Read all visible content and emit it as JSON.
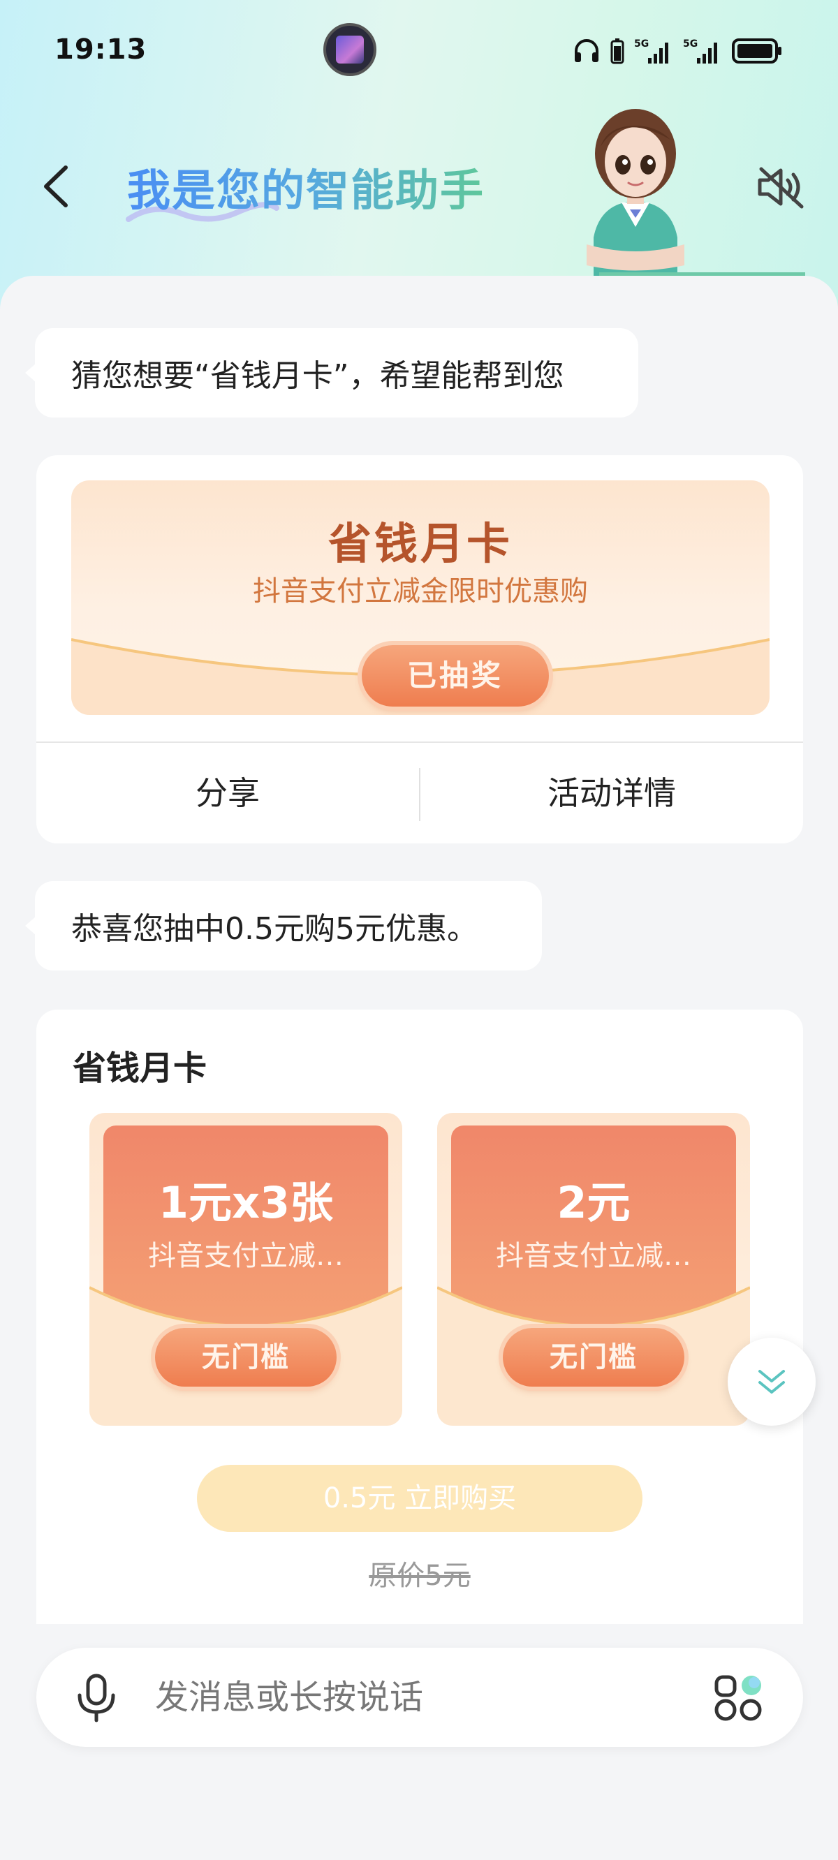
{
  "status_bar": {
    "time": "19:13",
    "network_1": "5G",
    "network_2": "5G"
  },
  "header": {
    "title": "我是您的智能助手"
  },
  "messages": [
    {
      "text": "猜您想要“省钱月卡”，希望能帮到您"
    },
    {
      "text": "恭喜您抽中0.5元购5元优惠。"
    }
  ],
  "promo_card": {
    "title": "省钱月卡",
    "subtitle": "抖音支付立减金限时优惠购",
    "status_button": "已抽奖",
    "actions": {
      "share": "分享",
      "details": "活动详情"
    }
  },
  "product_card": {
    "title": "省钱月卡",
    "coupons": [
      {
        "amount": "1元x3张",
        "desc": "抖音支付立减…",
        "tag": "无门槛"
      },
      {
        "amount": "2元",
        "desc": "抖音支付立减…",
        "tag": "无门槛"
      }
    ],
    "buy_button": "0.5元 立即购买",
    "original_price": "原价5元"
  },
  "input": {
    "placeholder": "发消息或长按说话"
  },
  "colors": {
    "title_gradient_start": "#4a8ef3",
    "title_gradient_end": "#5ec79b",
    "accent_orange": "#ef7d4f",
    "buy_button_disabled": "#fde7b8"
  }
}
